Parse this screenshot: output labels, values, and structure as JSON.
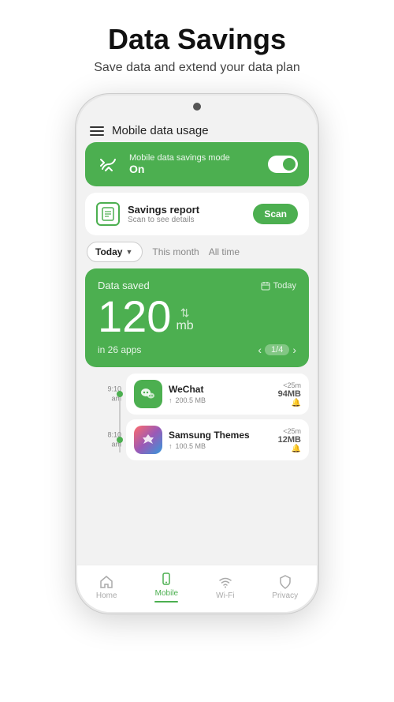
{
  "page": {
    "title": "Data Savings",
    "subtitle": "Save data and extend your data plan"
  },
  "phone": {
    "topBar": {
      "title": "Mobile data usage"
    },
    "banner": {
      "title": "Mobile data savings mode",
      "status": "On"
    },
    "savingsReport": {
      "title": "Savings report",
      "subtitle": "Scan to see details",
      "scanLabel": "Scan"
    },
    "periods": {
      "today": "Today",
      "thisMonth": "This month",
      "allTime": "All time"
    },
    "dataSaved": {
      "title": "Data saved",
      "dateLabel": "Today",
      "amount": "120",
      "unit": "mb",
      "appsText": "in 26 apps",
      "page": "1/4"
    },
    "apps": [
      {
        "time": "9:10\nam",
        "name": "WeChat",
        "dataTransfer": "200.5 MB",
        "limitLabel": "<25m",
        "saved": "94MB",
        "type": "wechat"
      },
      {
        "time": "8:10\nam",
        "name": "Samsung Themes",
        "dataTransfer": "100.5 MB",
        "limitLabel": "<25m",
        "saved": "12MB",
        "type": "samsung"
      }
    ],
    "nav": [
      {
        "label": "Home",
        "active": false,
        "icon": "home"
      },
      {
        "label": "Mobile",
        "active": true,
        "icon": "mobile"
      },
      {
        "label": "Wi-Fi",
        "active": false,
        "icon": "wifi"
      },
      {
        "label": "Privacy",
        "active": false,
        "icon": "privacy"
      }
    ]
  }
}
